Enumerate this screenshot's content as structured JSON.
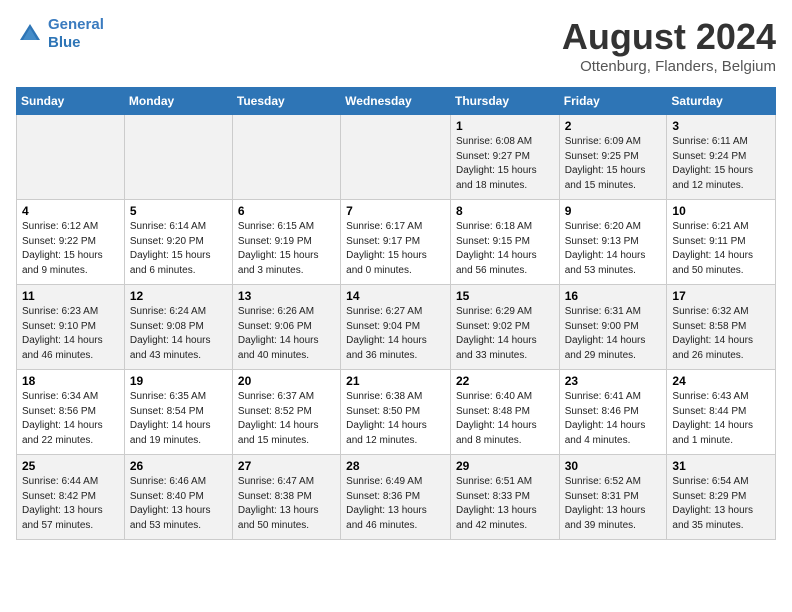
{
  "header": {
    "logo_line1": "General",
    "logo_line2": "Blue",
    "month_year": "August 2024",
    "location": "Ottenburg, Flanders, Belgium"
  },
  "weekdays": [
    "Sunday",
    "Monday",
    "Tuesday",
    "Wednesday",
    "Thursday",
    "Friday",
    "Saturday"
  ],
  "weeks": [
    [
      {
        "day": "",
        "info": ""
      },
      {
        "day": "",
        "info": ""
      },
      {
        "day": "",
        "info": ""
      },
      {
        "day": "",
        "info": ""
      },
      {
        "day": "1",
        "info": "Sunrise: 6:08 AM\nSunset: 9:27 PM\nDaylight: 15 hours\nand 18 minutes."
      },
      {
        "day": "2",
        "info": "Sunrise: 6:09 AM\nSunset: 9:25 PM\nDaylight: 15 hours\nand 15 minutes."
      },
      {
        "day": "3",
        "info": "Sunrise: 6:11 AM\nSunset: 9:24 PM\nDaylight: 15 hours\nand 12 minutes."
      }
    ],
    [
      {
        "day": "4",
        "info": "Sunrise: 6:12 AM\nSunset: 9:22 PM\nDaylight: 15 hours\nand 9 minutes."
      },
      {
        "day": "5",
        "info": "Sunrise: 6:14 AM\nSunset: 9:20 PM\nDaylight: 15 hours\nand 6 minutes."
      },
      {
        "day": "6",
        "info": "Sunrise: 6:15 AM\nSunset: 9:19 PM\nDaylight: 15 hours\nand 3 minutes."
      },
      {
        "day": "7",
        "info": "Sunrise: 6:17 AM\nSunset: 9:17 PM\nDaylight: 15 hours\nand 0 minutes."
      },
      {
        "day": "8",
        "info": "Sunrise: 6:18 AM\nSunset: 9:15 PM\nDaylight: 14 hours\nand 56 minutes."
      },
      {
        "day": "9",
        "info": "Sunrise: 6:20 AM\nSunset: 9:13 PM\nDaylight: 14 hours\nand 53 minutes."
      },
      {
        "day": "10",
        "info": "Sunrise: 6:21 AM\nSunset: 9:11 PM\nDaylight: 14 hours\nand 50 minutes."
      }
    ],
    [
      {
        "day": "11",
        "info": "Sunrise: 6:23 AM\nSunset: 9:10 PM\nDaylight: 14 hours\nand 46 minutes."
      },
      {
        "day": "12",
        "info": "Sunrise: 6:24 AM\nSunset: 9:08 PM\nDaylight: 14 hours\nand 43 minutes."
      },
      {
        "day": "13",
        "info": "Sunrise: 6:26 AM\nSunset: 9:06 PM\nDaylight: 14 hours\nand 40 minutes."
      },
      {
        "day": "14",
        "info": "Sunrise: 6:27 AM\nSunset: 9:04 PM\nDaylight: 14 hours\nand 36 minutes."
      },
      {
        "day": "15",
        "info": "Sunrise: 6:29 AM\nSunset: 9:02 PM\nDaylight: 14 hours\nand 33 minutes."
      },
      {
        "day": "16",
        "info": "Sunrise: 6:31 AM\nSunset: 9:00 PM\nDaylight: 14 hours\nand 29 minutes."
      },
      {
        "day": "17",
        "info": "Sunrise: 6:32 AM\nSunset: 8:58 PM\nDaylight: 14 hours\nand 26 minutes."
      }
    ],
    [
      {
        "day": "18",
        "info": "Sunrise: 6:34 AM\nSunset: 8:56 PM\nDaylight: 14 hours\nand 22 minutes."
      },
      {
        "day": "19",
        "info": "Sunrise: 6:35 AM\nSunset: 8:54 PM\nDaylight: 14 hours\nand 19 minutes."
      },
      {
        "day": "20",
        "info": "Sunrise: 6:37 AM\nSunset: 8:52 PM\nDaylight: 14 hours\nand 15 minutes."
      },
      {
        "day": "21",
        "info": "Sunrise: 6:38 AM\nSunset: 8:50 PM\nDaylight: 14 hours\nand 12 minutes."
      },
      {
        "day": "22",
        "info": "Sunrise: 6:40 AM\nSunset: 8:48 PM\nDaylight: 14 hours\nand 8 minutes."
      },
      {
        "day": "23",
        "info": "Sunrise: 6:41 AM\nSunset: 8:46 PM\nDaylight: 14 hours\nand 4 minutes."
      },
      {
        "day": "24",
        "info": "Sunrise: 6:43 AM\nSunset: 8:44 PM\nDaylight: 14 hours\nand 1 minute."
      }
    ],
    [
      {
        "day": "25",
        "info": "Sunrise: 6:44 AM\nSunset: 8:42 PM\nDaylight: 13 hours\nand 57 minutes."
      },
      {
        "day": "26",
        "info": "Sunrise: 6:46 AM\nSunset: 8:40 PM\nDaylight: 13 hours\nand 53 minutes."
      },
      {
        "day": "27",
        "info": "Sunrise: 6:47 AM\nSunset: 8:38 PM\nDaylight: 13 hours\nand 50 minutes."
      },
      {
        "day": "28",
        "info": "Sunrise: 6:49 AM\nSunset: 8:36 PM\nDaylight: 13 hours\nand 46 minutes."
      },
      {
        "day": "29",
        "info": "Sunrise: 6:51 AM\nSunset: 8:33 PM\nDaylight: 13 hours\nand 42 minutes."
      },
      {
        "day": "30",
        "info": "Sunrise: 6:52 AM\nSunset: 8:31 PM\nDaylight: 13 hours\nand 39 minutes."
      },
      {
        "day": "31",
        "info": "Sunrise: 6:54 AM\nSunset: 8:29 PM\nDaylight: 13 hours\nand 35 minutes."
      }
    ]
  ]
}
